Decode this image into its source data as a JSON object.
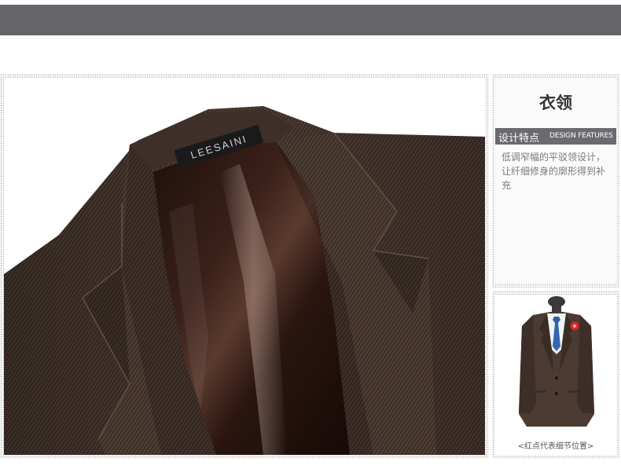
{
  "brand_label": "LEESAINI",
  "section": {
    "title": "衣领",
    "feature_label_cn": "设计特点",
    "feature_label_en": "DESIGN FEATURES",
    "description": "低调窄幅的平驳领设计，让纤细修身的廓形得到补充"
  },
  "thumbnail": {
    "caption": "<红点代表细节位置>"
  },
  "colors": {
    "top_bar": "#656469",
    "jacket_brown": "#4a3a31",
    "lining": "#2a1510",
    "marker_red": "#d8262e"
  },
  "icons": {
    "detail_marker": "red-dot-marker-icon"
  }
}
